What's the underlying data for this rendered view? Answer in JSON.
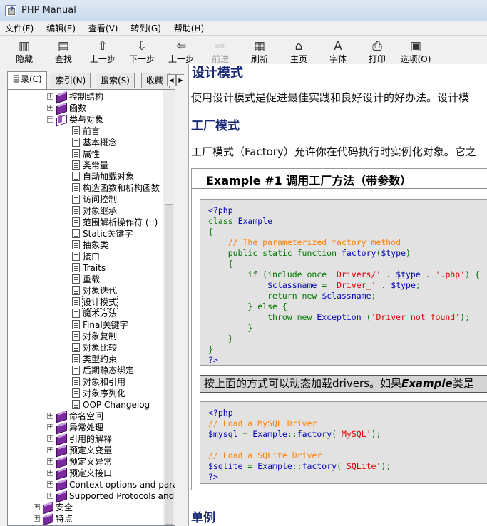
{
  "window": {
    "title": "PHP Manual"
  },
  "menu": [
    "文件(F)",
    "编辑(E)",
    "查看(V)",
    "转到(G)",
    "帮助(H)"
  ],
  "toolbar": [
    {
      "label": "隐藏",
      "icon": "hide-icon",
      "enabled": true
    },
    {
      "label": "查找",
      "icon": "locate-icon",
      "enabled": true
    },
    {
      "label": "上一步",
      "icon": "arrow-up-icon",
      "enabled": true
    },
    {
      "label": "下一步",
      "icon": "arrow-down-icon",
      "enabled": true
    },
    {
      "label": "上一步",
      "icon": "back-arrow-icon",
      "enabled": true
    },
    {
      "label": "前进",
      "icon": "forward-arrow-icon",
      "enabled": false
    },
    {
      "label": "刷新",
      "icon": "refresh-icon",
      "enabled": true
    },
    {
      "label": "主页",
      "icon": "home-icon",
      "enabled": true
    },
    {
      "label": "字体",
      "icon": "font-icon",
      "enabled": true
    },
    {
      "label": "打印",
      "icon": "print-icon",
      "enabled": true
    },
    {
      "label": "选项(O)",
      "icon": "options-icon",
      "enabled": true
    }
  ],
  "nav_tabs": [
    "目录(C)",
    "索引(N)",
    "搜索(S)",
    "收藏"
  ],
  "tree": {
    "top_items": [
      "控制结构",
      "函数"
    ],
    "open_item": "类与对象",
    "children": [
      "前言",
      "基本概念",
      "属性",
      "类常量",
      "自动加载对象",
      "构造函数和析构函数",
      "访问控制",
      "对象继承",
      "范围解析操作符 (::)",
      "Static关键字",
      "抽象类",
      "接口",
      "Traits",
      "重载",
      "对象迭代",
      "设计模式",
      "魔术方法",
      "Final关键字",
      "对象复制",
      "对象比较",
      "类型约束",
      "后期静态绑定",
      "对象和引用",
      "对象序列化",
      "OOP Changelog"
    ],
    "selected": "设计模式",
    "after_items": [
      "命名空间",
      "异常处理",
      "引用的解释",
      "预定义变量",
      "预定义异常",
      "预定义接口",
      "Context options and parameters",
      "Supported Protocols and Wrappers"
    ],
    "outer_items": [
      "安全",
      "特点"
    ]
  },
  "content": {
    "heading": "设计模式",
    "intro": "使用设计模式是促进最佳实践和良好设计的好办法。设计模",
    "factory_heading": "工厂模式",
    "factory_text": "工厂模式（Factory）允许你在代码执行时实例化对象。它之",
    "example_title": "Example #1 调用工厂方法（带参数）",
    "note_prefix": "按上面的方式可以动态加载drivers。如果",
    "note_bold": "Example",
    "note_suffix": "类是",
    "singleton_heading": "单例"
  },
  "colors": {
    "heading": "#1b2a78",
    "code_keyword": "#007700",
    "code_string": "#dd0000",
    "code_comment": "#ff8000",
    "code_default": "#0000bb"
  }
}
